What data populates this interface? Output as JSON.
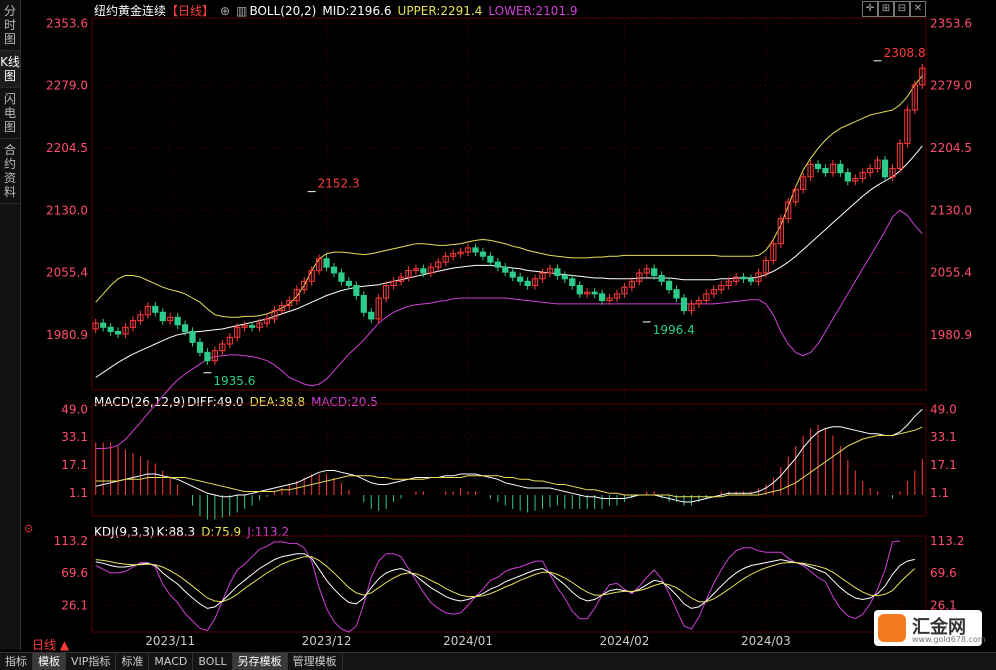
{
  "sidebar": {
    "tabs": [
      "分时图",
      "K线图",
      "闪电图",
      "合约资料"
    ],
    "active": 1
  },
  "header": {
    "instrument": "纽约黄金连续",
    "period": "【日线】",
    "boll": "BOLL(20,2)",
    "mid": "MID:2196.6",
    "upper": "UPPER:2291.4",
    "lower": "LOWER:2101.9"
  },
  "macd_header": {
    "name": "MACD(26,12,9)",
    "diff": "DIFF:49.0",
    "dea": "DEA:38.8",
    "macd": "MACD:20.5"
  },
  "kdj_header": {
    "name": "KDJ(9,3,3)",
    "k": "K:88.3",
    "d": "D:75.9",
    "j": "J:113.2"
  },
  "toolbar_icons": [
    "crosshair-icon",
    "zoom-in-icon",
    "zoom-out-icon",
    "close-icon"
  ],
  "colors": {
    "up": "#ff3b3b",
    "down": "#2ecc8a",
    "boll_mid": "#ffffff",
    "boll_upper": "#e8e05a",
    "boll_lower": "#d040d8",
    "axis": "#ff4d6d",
    "grid": "#2a0000"
  },
  "chart_data": [
    {
      "type": "candlestick",
      "title": "纽约黄金连续 日线",
      "y_ticks": [
        1980.9,
        2055.4,
        2130.0,
        2204.5,
        2279.0,
        2353.6
      ],
      "y_tick_labels": [
        "1980.9",
        "2055.4",
        "2130.0",
        "2204.5",
        "2279.0",
        "2353.6"
      ],
      "ylim": [
        1915,
        2360
      ],
      "x_labels": [
        "2023/11",
        "2023/12",
        "2024/01",
        "2024/02",
        "2024/03"
      ],
      "x_label_index": [
        10,
        31,
        50,
        71,
        90
      ],
      "annotations": [
        {
          "label": "2152.3",
          "index": 29,
          "value": 2152.3
        },
        {
          "label": "1935.6",
          "index": 15,
          "value": 1935.6
        },
        {
          "label": "1996.4",
          "index": 74,
          "value": 1996.4
        },
        {
          "label": "2308.8",
          "index": 105,
          "value": 2308.8
        }
      ],
      "close": [
        1995,
        1990,
        1985,
        1982,
        1990,
        1998,
        2005,
        2015,
        2008,
        1998,
        2002,
        1993,
        1985,
        1972,
        1960,
        1950,
        1962,
        1970,
        1978,
        1990,
        1992,
        1990,
        1995,
        2000,
        2010,
        2016,
        2022,
        2035,
        2045,
        2058,
        2072,
        2062,
        2055,
        2045,
        2040,
        2028,
        2008,
        2000,
        2025,
        2040,
        2045,
        2050,
        2058,
        2060,
        2055,
        2062,
        2068,
        2075,
        2078,
        2080,
        2085,
        2080,
        2075,
        2068,
        2062,
        2056,
        2050,
        2045,
        2040,
        2048,
        2055,
        2060,
        2052,
        2048,
        2040,
        2030,
        2032,
        2030,
        2022,
        2025,
        2030,
        2038,
        2045,
        2055,
        2060,
        2052,
        2045,
        2035,
        2025,
        2010,
        2018,
        2022,
        2030,
        2035,
        2040,
        2045,
        2050,
        2048,
        2045,
        2055,
        2070,
        2090,
        2120,
        2140,
        2155,
        2170,
        2185,
        2180,
        2175,
        2185,
        2175,
        2165,
        2168,
        2175,
        2180,
        2190,
        2170,
        2180,
        2210,
        2250,
        2280,
        2300
      ],
      "open": [
        1988,
        1995,
        1990,
        1985,
        1982,
        1990,
        1998,
        2005,
        2015,
        2008,
        1998,
        2002,
        1993,
        1985,
        1972,
        1960,
        1950,
        1962,
        1970,
        1978,
        1990,
        1992,
        1990,
        1995,
        2000,
        2010,
        2016,
        2022,
        2035,
        2045,
        2058,
        2072,
        2062,
        2055,
        2045,
        2040,
        2028,
        2008,
        2000,
        2025,
        2040,
        2045,
        2050,
        2058,
        2060,
        2055,
        2062,
        2068,
        2075,
        2078,
        2080,
        2085,
        2080,
        2075,
        2068,
        2062,
        2056,
        2050,
        2045,
        2040,
        2048,
        2055,
        2060,
        2052,
        2048,
        2040,
        2030,
        2032,
        2030,
        2022,
        2025,
        2030,
        2038,
        2045,
        2055,
        2060,
        2052,
        2045,
        2035,
        2025,
        2010,
        2018,
        2022,
        2030,
        2035,
        2040,
        2045,
        2050,
        2048,
        2045,
        2055,
        2070,
        2090,
        2120,
        2140,
        2155,
        2170,
        2185,
        2180,
        2175,
        2185,
        2175,
        2165,
        2168,
        2175,
        2180,
        2190,
        2170,
        2180,
        2210,
        2250,
        2280
      ],
      "boll_mid": [
        1930,
        1936,
        1942,
        1948,
        1953,
        1958,
        1962,
        1966,
        1970,
        1974,
        1978,
        1981,
        1983,
        1984,
        1985,
        1986,
        1987,
        1988,
        1990,
        1992,
        1994,
        1996,
        1998,
        2000,
        2003,
        2006,
        2009,
        2012,
        2016,
        2020,
        2024,
        2028,
        2031,
        2034,
        2036,
        2038,
        2039,
        2040,
        2041,
        2043,
        2045,
        2047,
        2049,
        2051,
        2053,
        2055,
        2057,
        2059,
        2061,
        2062,
        2063,
        2064,
        2064,
        2064,
        2063,
        2062,
        2061,
        2060,
        2058,
        2057,
        2056,
        2055,
        2054,
        2053,
        2052,
        2051,
        2050,
        2049,
        2049,
        2048,
        2048,
        2048,
        2048,
        2049,
        2049,
        2049,
        2049,
        2049,
        2048,
        2047,
        2047,
        2047,
        2047,
        2047,
        2048,
        2048,
        2049,
        2049,
        2049,
        2050,
        2053,
        2057,
        2062,
        2068,
        2075,
        2083,
        2091,
        2099,
        2107,
        2115,
        2123,
        2131,
        2139,
        2147,
        2154,
        2160,
        2165,
        2170,
        2177,
        2186,
        2196,
        2207
      ],
      "boll_upper": [
        2020,
        2030,
        2040,
        2048,
        2052,
        2052,
        2050,
        2046,
        2042,
        2038,
        2035,
        2033,
        2030,
        2025,
        2020,
        2012,
        2005,
        2003,
        2002,
        2002,
        2003,
        2003,
        2004,
        2006,
        2009,
        2013,
        2018,
        2027,
        2040,
        2058,
        2072,
        2078,
        2080,
        2080,
        2079,
        2078,
        2077,
        2078,
        2080,
        2082,
        2084,
        2086,
        2088,
        2090,
        2090,
        2089,
        2088,
        2088,
        2089,
        2090,
        2092,
        2094,
        2095,
        2094,
        2092,
        2090,
        2087,
        2085,
        2082,
        2080,
        2078,
        2076,
        2075,
        2074,
        2073,
        2073,
        2073,
        2074,
        2074,
        2075,
        2075,
        2076,
        2076,
        2076,
        2076,
        2076,
        2076,
        2076,
        2076,
        2076,
        2076,
        2076,
        2076,
        2076,
        2075,
        2075,
        2075,
        2075,
        2075,
        2076,
        2082,
        2095,
        2112,
        2135,
        2158,
        2178,
        2192,
        2204,
        2214,
        2222,
        2228,
        2232,
        2236,
        2240,
        2244,
        2246,
        2248,
        2250,
        2256,
        2266,
        2280,
        2291
      ],
      "boll_lower": [
        1845,
        1845,
        1846,
        1849,
        1856,
        1866,
        1876,
        1887,
        1897,
        1908,
        1918,
        1927,
        1934,
        1940,
        1946,
        1952,
        1955,
        1956,
        1957,
        1957,
        1956,
        1955,
        1953,
        1950,
        1945,
        1938,
        1930,
        1926,
        1922,
        1920,
        1922,
        1928,
        1938,
        1948,
        1958,
        1966,
        1975,
        1985,
        1995,
        2002,
        2008,
        2012,
        2015,
        2017,
        2018,
        2019,
        2021,
        2022,
        2024,
        2025,
        2025,
        2025,
        2025,
        2025,
        2025,
        2025,
        2024,
        2023,
        2022,
        2021,
        2020,
        2019,
        2018,
        2018,
        2018,
        2018,
        2018,
        2018,
        2018,
        2018,
        2018,
        2018,
        2018,
        2018,
        2018,
        2018,
        2018,
        2018,
        2018,
        2018,
        2018,
        2018,
        2018,
        2018,
        2019,
        2020,
        2021,
        2022,
        2023,
        2023,
        2018,
        2005,
        1985,
        1970,
        1960,
        1956,
        1960,
        1970,
        1985,
        2000,
        2015,
        2030,
        2045,
        2060,
        2075,
        2090,
        2105,
        2122,
        2130,
        2124,
        2112,
        2101.9
      ]
    },
    {
      "type": "macd",
      "y_ticks": [
        1.1,
        17.1,
        33.1,
        49.0
      ],
      "y_tick_labels": [
        "1.1",
        "17.1",
        "33.1",
        "49.0"
      ],
      "ylim": [
        -12,
        52
      ],
      "diff": [
        5,
        6,
        7,
        8,
        9,
        10,
        11,
        12,
        12,
        11,
        10,
        9,
        7,
        5,
        3,
        1,
        0,
        -1,
        -1,
        0,
        0,
        1,
        2,
        3,
        4,
        5,
        6,
        7,
        9,
        11,
        13,
        14,
        14,
        13,
        12,
        11,
        9,
        7,
        6,
        6,
        7,
        8,
        9,
        10,
        10,
        10,
        10,
        11,
        11,
        12,
        12,
        12,
        11,
        10,
        9,
        7,
        6,
        5,
        4,
        4,
        4,
        4,
        3,
        2,
        1,
        0,
        -1,
        -1,
        -2,
        -2,
        -2,
        -2,
        -1,
        0,
        0,
        0,
        -1,
        -2,
        -3,
        -4,
        -4,
        -3,
        -2,
        -1,
        0,
        1,
        1,
        1,
        1,
        2,
        4,
        7,
        11,
        16,
        21,
        27,
        32,
        36,
        38,
        39,
        39,
        38,
        37,
        36,
        35,
        35,
        34,
        34,
        36,
        40,
        45,
        49
      ],
      "dea": [
        8,
        8,
        8,
        8,
        9,
        9,
        9,
        10,
        10,
        10,
        10,
        10,
        10,
        9,
        8,
        7,
        6,
        5,
        4,
        3,
        2,
        2,
        2,
        2,
        2,
        3,
        3,
        4,
        5,
        6,
        7,
        8,
        9,
        10,
        11,
        11,
        11,
        11,
        10,
        10,
        9,
        9,
        9,
        9,
        9,
        10,
        10,
        10,
        10,
        10,
        11,
        11,
        11,
        11,
        11,
        10,
        10,
        9,
        9,
        8,
        8,
        7,
        6,
        6,
        5,
        4,
        3,
        3,
        2,
        1,
        1,
        0,
        0,
        0,
        0,
        0,
        0,
        0,
        -1,
        -1,
        -1,
        -1,
        -1,
        -1,
        -1,
        0,
        0,
        0,
        0,
        0,
        1,
        2,
        3,
        5,
        7,
        10,
        13,
        16,
        19,
        22,
        25,
        28,
        30,
        32,
        33,
        34,
        34,
        34,
        35,
        36,
        37,
        38.8
      ],
      "macd": [
        30,
        30,
        30,
        28,
        26,
        24,
        22,
        20,
        18,
        14,
        10,
        6,
        0,
        -6,
        -12,
        -14,
        -14,
        -13,
        -12,
        -10,
        -8,
        -6,
        -3,
        -1,
        2,
        4,
        6,
        8,
        10,
        12,
        12,
        12,
        10,
        7,
        3,
        0,
        -4,
        -8,
        -9,
        -8,
        -4,
        -2,
        0,
        2,
        2,
        0,
        0,
        2,
        2,
        4,
        2,
        2,
        0,
        -2,
        -4,
        -6,
        -8,
        -9,
        -10,
        -9,
        -8,
        -7,
        -6,
        -8,
        -8,
        -8,
        -8,
        -8,
        -8,
        -6,
        -6,
        -4,
        -2,
        0,
        2,
        2,
        -2,
        -4,
        -4,
        -6,
        -6,
        -4,
        -2,
        0,
        2,
        2,
        2,
        2,
        2,
        4,
        6,
        10,
        16,
        22,
        28,
        34,
        38,
        40,
        38,
        34,
        28,
        20,
        14,
        8,
        4,
        2,
        0,
        -2,
        2,
        8,
        14,
        20.5
      ]
    },
    {
      "type": "kdj",
      "y_ticks": [
        26.1,
        69.6,
        113.2
      ],
      "y_tick_labels": [
        "26.1",
        "69.6",
        "113.2"
      ],
      "ylim": [
        -10,
        120
      ],
      "k": [
        85,
        83,
        80,
        78,
        78,
        80,
        82,
        83,
        80,
        70,
        62,
        55,
        45,
        36,
        28,
        22,
        24,
        32,
        42,
        52,
        60,
        68,
        76,
        82,
        88,
        92,
        94,
        96,
        96,
        90,
        75,
        60,
        48,
        38,
        30,
        28,
        36,
        50,
        62,
        70,
        74,
        76,
        72,
        66,
        58,
        50,
        44,
        38,
        34,
        32,
        34,
        38,
        42,
        48,
        52,
        58,
        62,
        66,
        70,
        74,
        76,
        70,
        62,
        54,
        44,
        36,
        32,
        34,
        40,
        46,
        48,
        46,
        44,
        48,
        54,
        60,
        58,
        50,
        40,
        28,
        22,
        24,
        32,
        42,
        52,
        62,
        70,
        76,
        80,
        82,
        84,
        86,
        88,
        86,
        84,
        82,
        78,
        74,
        70,
        60,
        50,
        42,
        36,
        34,
        36,
        42,
        52,
        68,
        80,
        86,
        88.3
      ],
      "d": [
        88,
        87,
        85,
        83,
        82,
        81,
        81,
        82,
        81,
        78,
        73,
        67,
        60,
        52,
        44,
        36,
        32,
        31,
        35,
        41,
        49,
        56,
        63,
        70,
        76,
        82,
        86,
        89,
        92,
        92,
        87,
        79,
        70,
        60,
        50,
        43,
        40,
        43,
        50,
        57,
        63,
        68,
        70,
        69,
        65,
        60,
        55,
        49,
        44,
        40,
        38,
        38,
        39,
        42,
        46,
        51,
        55,
        60,
        64,
        68,
        71,
        71,
        68,
        63,
        57,
        50,
        44,
        40,
        40,
        42,
        44,
        45,
        45,
        46,
        49,
        53,
        56,
        54,
        50,
        43,
        36,
        31,
        31,
        35,
        41,
        48,
        55,
        62,
        68,
        73,
        77,
        80,
        83,
        84,
        84,
        83,
        81,
        79,
        76,
        71,
        64,
        57,
        50,
        44,
        40,
        39,
        41,
        46,
        57,
        67,
        75.9
      ],
      "j": [
        80,
        75,
        70,
        70,
        72,
        78,
        84,
        84,
        78,
        55,
        40,
        30,
        15,
        5,
        -5,
        -8,
        8,
        32,
        56,
        74,
        82,
        92,
        102,
        106,
        112,
        112,
        110,
        110,
        104,
        86,
        50,
        22,
        4,
        -6,
        -10,
        -2,
        28,
        64,
        86,
        96,
        96,
        92,
        76,
        60,
        44,
        30,
        22,
        16,
        14,
        16,
        26,
        38,
        48,
        60,
        64,
        72,
        76,
        78,
        82,
        86,
        86,
        68,
        50,
        36,
        18,
        8,
        8,
        22,
        40,
        54,
        56,
        48,
        42,
        52,
        64,
        74,
        62,
        42,
        20,
        -2,
        -6,
        10,
        34,
        56,
        74,
        90,
        100,
        104,
        104,
        100,
        98,
        98,
        98,
        90,
        84,
        80,
        72,
        64,
        58,
        38,
        22,
        12,
        8,
        14,
        28,
        48,
        74,
        112,
        113.2
      ]
    }
  ]
}
